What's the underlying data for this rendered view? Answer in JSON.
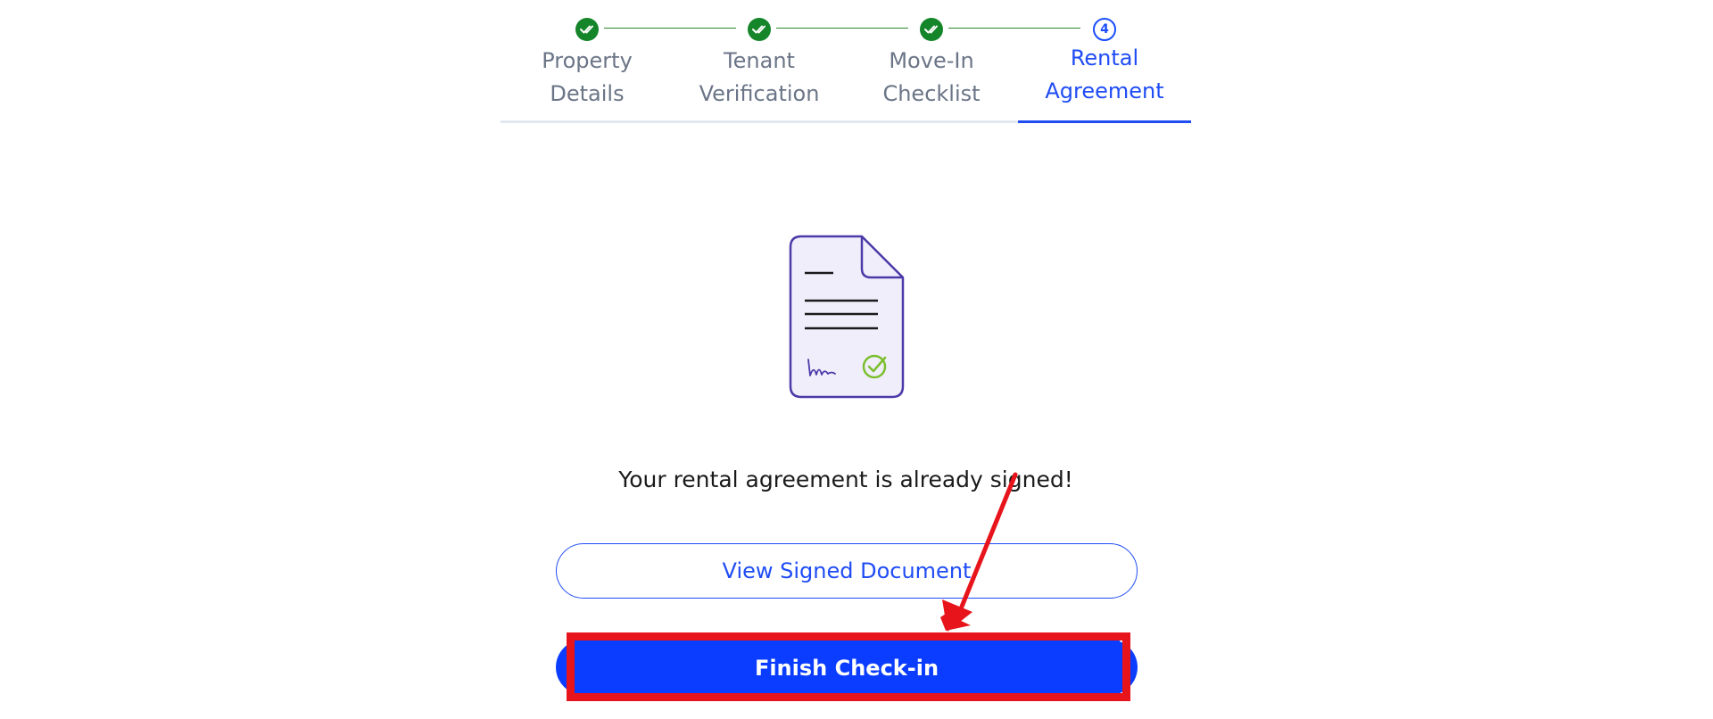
{
  "stepper": {
    "steps": [
      {
        "line1": "Property",
        "line2": "Details",
        "status": "completed",
        "icon": "double-check-icon"
      },
      {
        "line1": "Tenant",
        "line2": "Verification",
        "status": "completed",
        "icon": "double-check-icon"
      },
      {
        "line1": "Move-In",
        "line2": "Checklist",
        "status": "completed",
        "icon": "double-check-icon"
      },
      {
        "line1": "Rental",
        "line2": "Agreement",
        "status": "current",
        "number": "4"
      }
    ],
    "colors": {
      "completed": "#15852a",
      "active": "#1f4cf5",
      "inactive_text": "#6b7587"
    }
  },
  "illustration": {
    "icon": "signed-document-icon"
  },
  "message": "Your rental agreement is already signed!",
  "actions": {
    "view_label": "View Signed Document",
    "finish_label": "Finish Check-in"
  },
  "colors": {
    "primary": "#0a3dff",
    "annotation": "#e8141c"
  }
}
